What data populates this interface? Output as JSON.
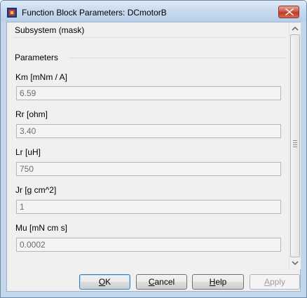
{
  "window": {
    "title": "Function Block Parameters: DCmotorB",
    "accent_close": "#c0382a"
  },
  "description": {
    "heading": "Subsystem (mask)"
  },
  "parameters": {
    "heading": "Parameters",
    "fields": [
      {
        "label": "Km [mNm / A]",
        "value": "6.59"
      },
      {
        "label": "Rr [ohm]",
        "value": "3.40"
      },
      {
        "label": "Lr [uH]",
        "value": "750"
      },
      {
        "label": "Jr [g cm^2]",
        "value": "1"
      },
      {
        "label": "Mu [mN cm s]",
        "value": "0.0002"
      }
    ]
  },
  "buttons": {
    "ok": {
      "mnemonic": "O",
      "rest": "K"
    },
    "cancel": {
      "mnemonic": "C",
      "rest": "ancel"
    },
    "help": {
      "mnemonic": "H",
      "rest": "elp"
    },
    "apply": {
      "mnemonic": "A",
      "rest": "pply"
    }
  },
  "icons": {
    "app": "simulink-block-icon",
    "close": "close-icon",
    "scroll_up": "chevron-up-icon",
    "scroll_down": "chevron-down-icon"
  }
}
